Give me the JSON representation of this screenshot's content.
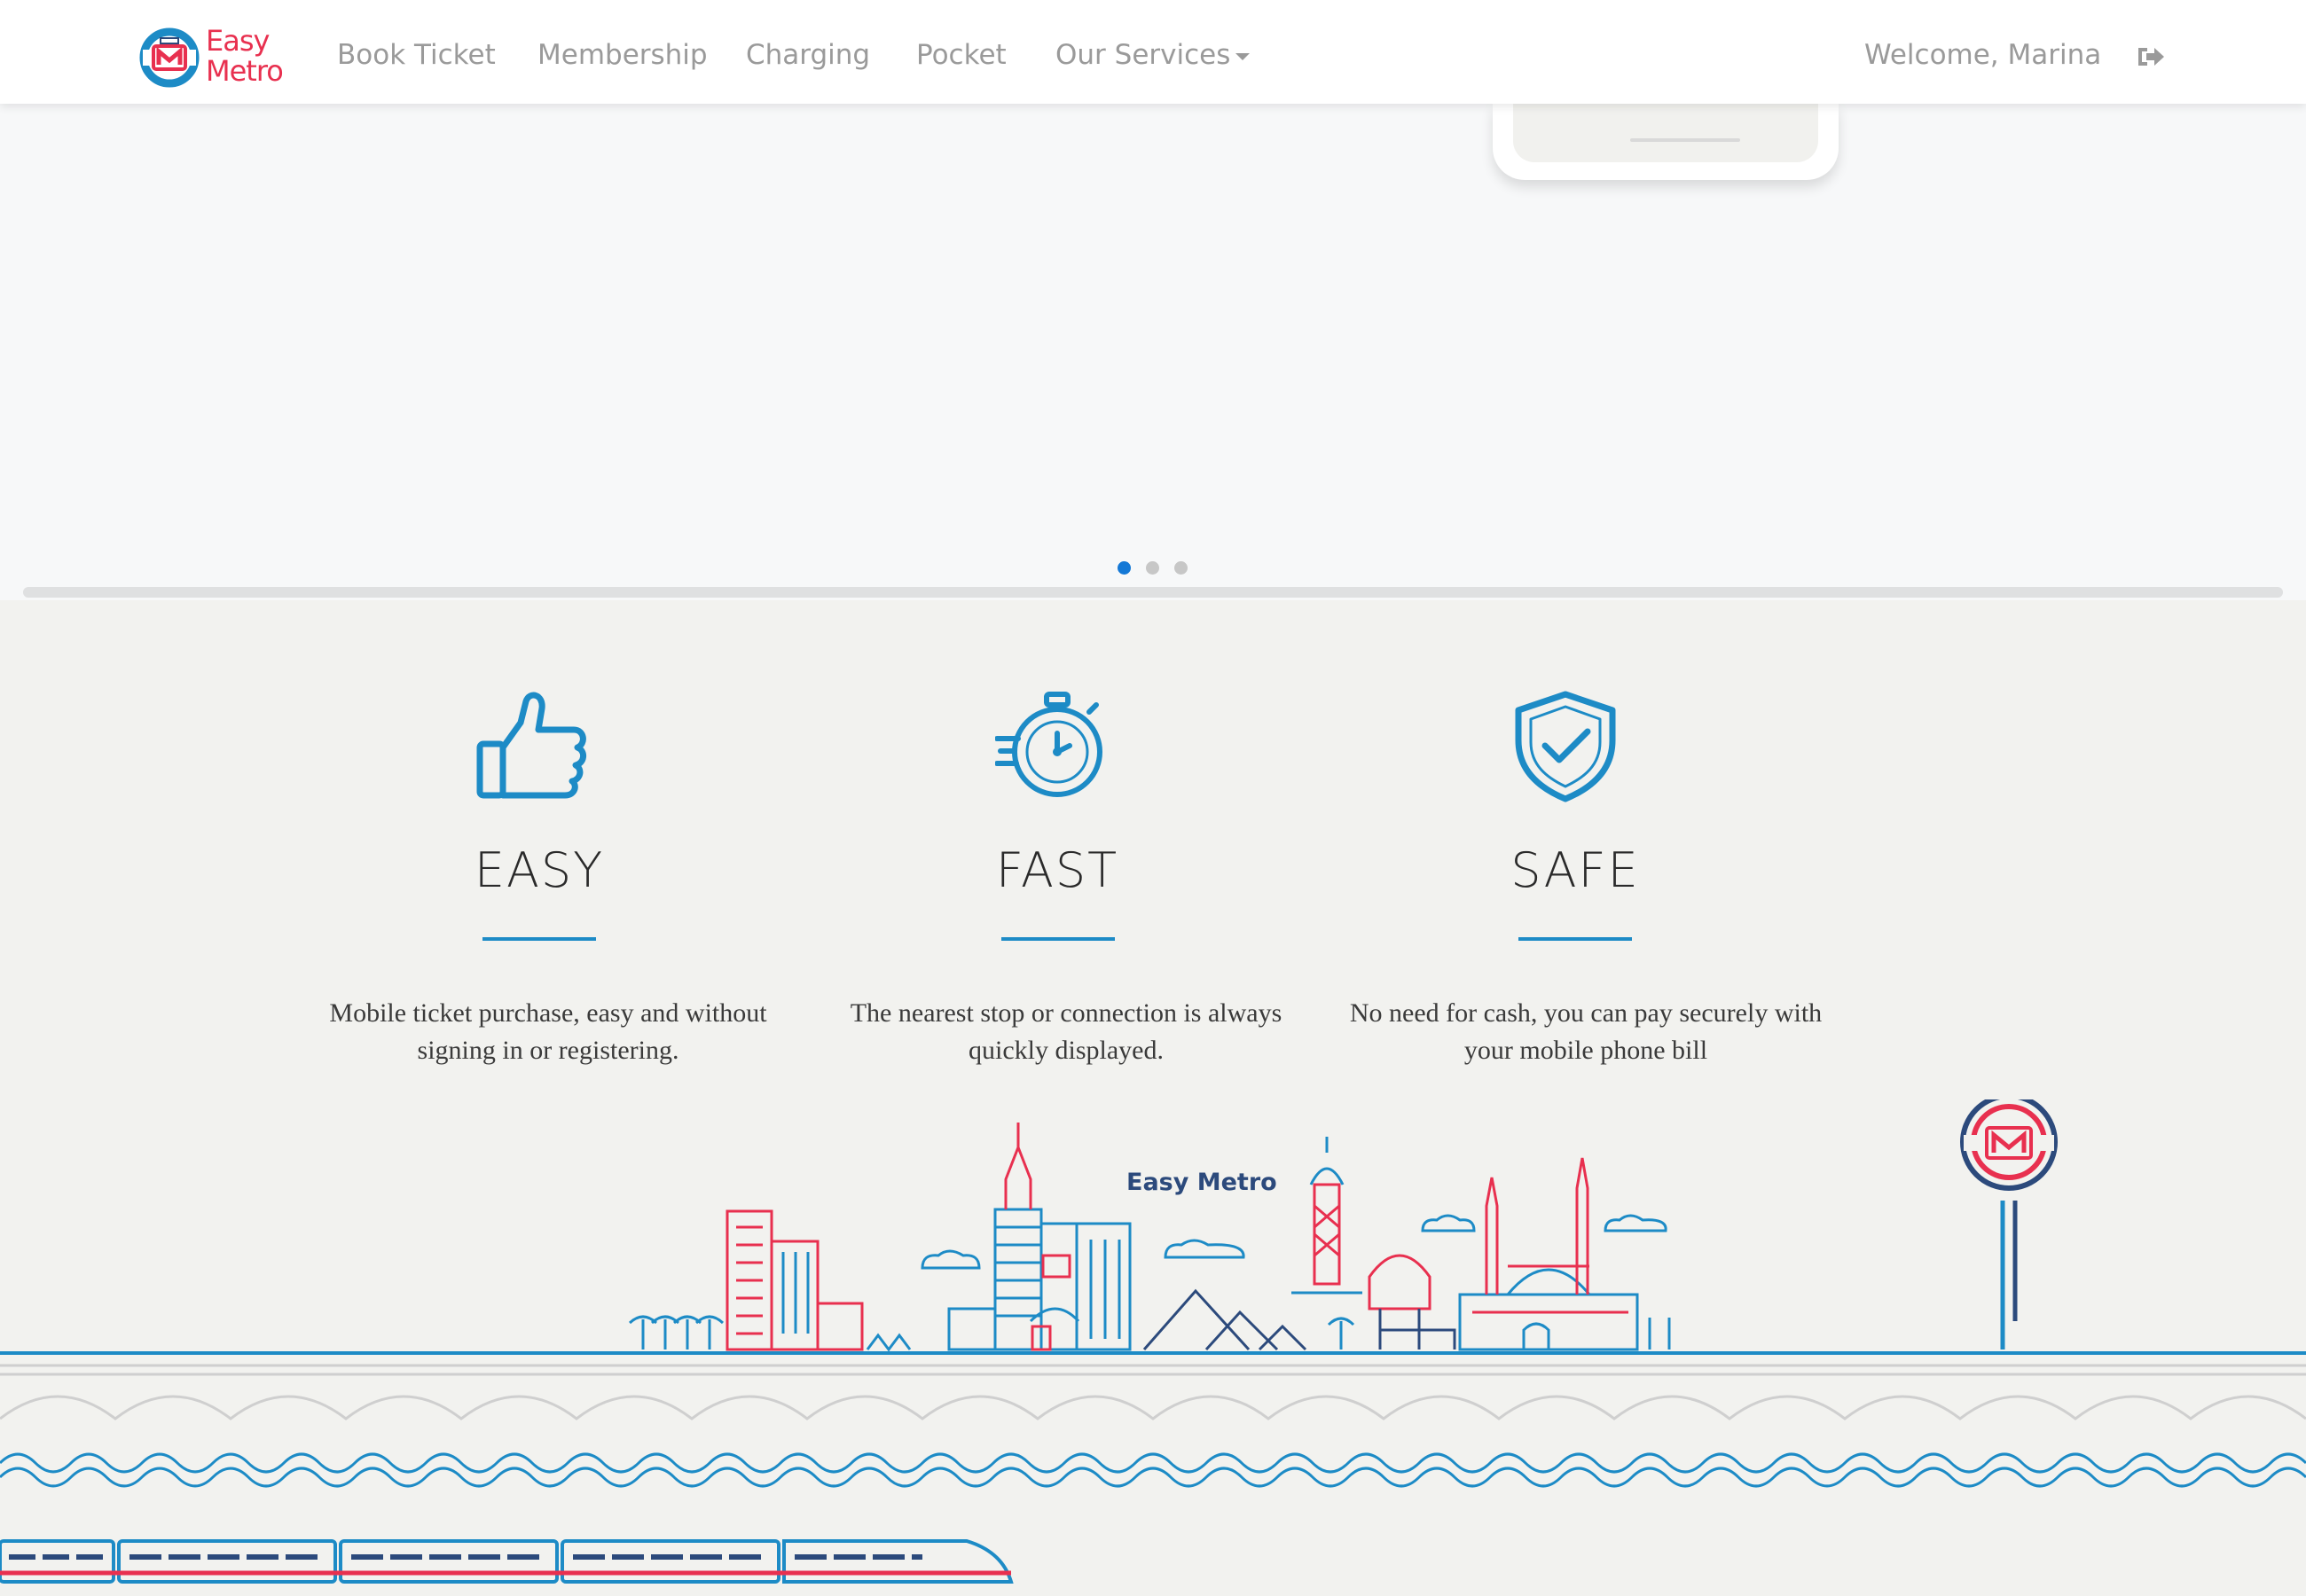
{
  "brand": {
    "name_line1": "Easy",
    "name_line2": "Metro"
  },
  "nav": {
    "book_ticket": "Book Ticket",
    "membership": "Membership",
    "charging": "Charging",
    "pocket": "Pocket",
    "our_services": "Our Services",
    "welcome": "Welcome, Marina"
  },
  "carousel": {
    "slide_count": 3,
    "active_index": 0
  },
  "features": [
    {
      "title": "EASY",
      "icon": "thumbs-up-icon",
      "description": "Mobile ticket purchase, easy and without signing in or registering."
    },
    {
      "title": "FAST",
      "icon": "stopwatch-icon",
      "description": "The nearest stop or connection is always quickly displayed."
    },
    {
      "title": "SAFE",
      "icon": "shield-check-icon",
      "description": "No need for cash, you can pay securely with your mobile phone bill"
    }
  ],
  "illustration": {
    "label": "Easy Metro"
  },
  "colors": {
    "brand_red": "#e8304f",
    "brand_blue": "#1d8bc6",
    "navy": "#2c4a7c",
    "active_dot": "#1478d6"
  }
}
